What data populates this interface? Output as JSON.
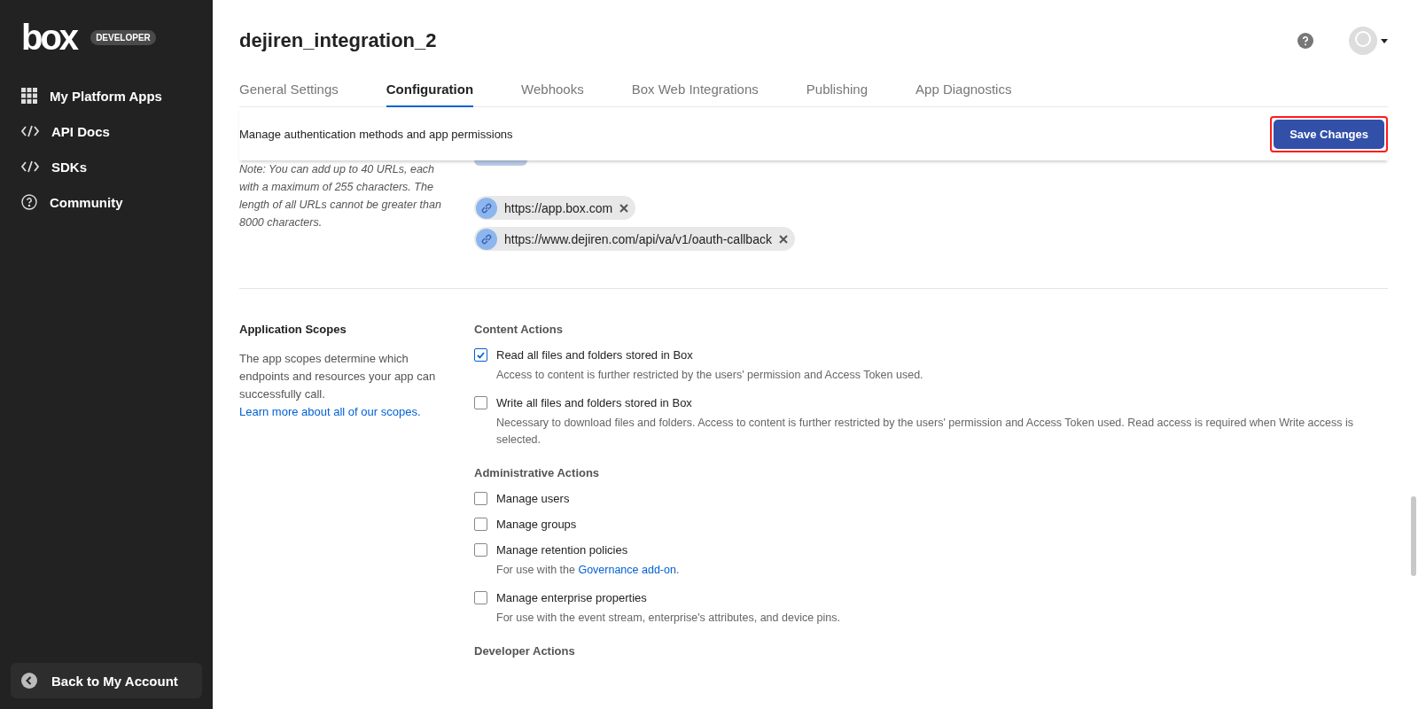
{
  "sidebar": {
    "logo": "box",
    "badge": "DEVELOPER",
    "items": [
      {
        "label": "My Platform Apps",
        "kind": "apps"
      },
      {
        "label": "API Docs",
        "kind": "docs"
      },
      {
        "label": "SDKs",
        "kind": "docs"
      },
      {
        "label": "Community",
        "kind": "community"
      }
    ],
    "back_button": "Back to My Account"
  },
  "header": {
    "title": "dejiren_integration_2"
  },
  "tabs": [
    {
      "label": "General Settings",
      "selected": false
    },
    {
      "label": "Configuration",
      "selected": true
    },
    {
      "label": "Webhooks",
      "selected": false
    },
    {
      "label": "Box Web Integrations",
      "selected": false
    },
    {
      "label": "Publishing",
      "selected": false
    },
    {
      "label": "App Diagnostics",
      "selected": false
    }
  ],
  "action_bar": {
    "description": "Manage authentication methods and app permissions",
    "save_button": "Save Changes",
    "highlighted": true
  },
  "redirect_uris": {
    "note": "Note: You can add up to 40 URLs, each with a maximum of 255 characters. The length of all URLs cannot be greater than 8000 characters.",
    "uris": [
      "https://app.box.com",
      "https://www.dejiren.com/api/va/v1/oauth-callback"
    ]
  },
  "scopes": {
    "title": "Application Scopes",
    "description": "The app scopes determine which endpoints and resources your app can successfully call. ",
    "link": "Learn more about all of our scopes.",
    "groups": [
      {
        "heading": "Content Actions",
        "items": [
          {
            "label": "Read all files and folders stored in Box",
            "checked": true,
            "description": {
              "text": "Access to content is further restricted by the users' permission and Access Token used."
            }
          },
          {
            "label": "Write all files and folders stored in Box",
            "checked": false,
            "description": {
              "text": "Necessary to download files and folders. Access to content is further restricted by the users' permission and Access Token used. Read access is required when Write access is selected."
            }
          }
        ]
      },
      {
        "heading": "Administrative Actions",
        "items": [
          {
            "label": "Manage users",
            "checked": false
          },
          {
            "label": "Manage groups",
            "checked": false
          },
          {
            "label": "Manage retention policies",
            "checked": false,
            "description": {
              "text": "For use with the ",
              "link": "Governance add-on",
              "after": "."
            }
          },
          {
            "label": "Manage enterprise properties",
            "checked": false,
            "description": {
              "text": "For use with the event stream, enterprise's attributes, and device pins."
            }
          }
        ]
      },
      {
        "heading": "Developer Actions"
      }
    ]
  }
}
